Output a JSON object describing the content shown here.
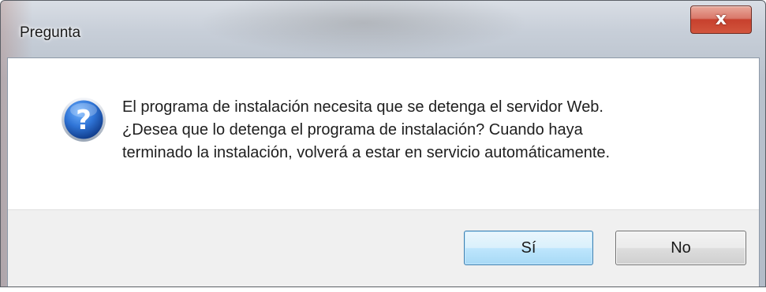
{
  "window": {
    "title": "Pregunta",
    "close_glyph": "x"
  },
  "message": {
    "icon": "question-icon",
    "lines": [
      "El programa de instalación necesita que se detenga el servidor Web.",
      "¿Desea que lo detenga el programa de instalación? Cuando haya",
      "terminado la instalación, volverá a estar en servicio automáticamente."
    ]
  },
  "buttons": {
    "yes_label": "Sí",
    "no_label": "No"
  },
  "colors": {
    "icon_blue": "#1f5fb8",
    "default_button_border": "#3c7fb1",
    "close_button_red": "#c7402d"
  }
}
